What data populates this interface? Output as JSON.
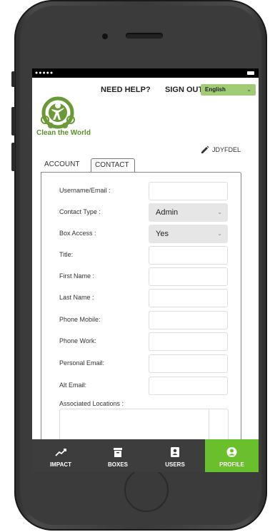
{
  "header": {
    "need_help": "NEED HELP?",
    "sign_out": "SIGN OUT",
    "language": "English"
  },
  "brand": {
    "logo_text": "Clean the World",
    "accent": "#6abf2c",
    "logo_green": "#5a8f2a"
  },
  "user": {
    "name": "JDYFDEL"
  },
  "tabs": [
    {
      "label": "ACCOUNT"
    },
    {
      "label": "CONTACT"
    }
  ],
  "form": {
    "username": {
      "label": "Username/Email :"
    },
    "contact_type": {
      "label": "Contact Type :",
      "value": "Admin"
    },
    "box_access": {
      "label": "Box Access :",
      "value": "Yes"
    },
    "title": {
      "label": "Title:"
    },
    "first_name": {
      "label": "First Name :"
    },
    "last_name": {
      "label": "Last Name :"
    },
    "phone_mobile": {
      "label": "Phone Mobile:"
    },
    "phone_work": {
      "label": "Phone Work:"
    },
    "personal_email": {
      "label": "Personal Email:"
    },
    "alt_email": {
      "label": "Alt Email:"
    },
    "associated_locations": {
      "label": "Associated Locations :"
    }
  },
  "bottom_nav": [
    {
      "label": "IMPACT",
      "icon": "trending-up-icon"
    },
    {
      "label": "BOXES",
      "icon": "archive-box-icon"
    },
    {
      "label": "USERS",
      "icon": "contacts-icon"
    },
    {
      "label": "PROFILE",
      "icon": "user-circle-icon",
      "active": true
    }
  ]
}
